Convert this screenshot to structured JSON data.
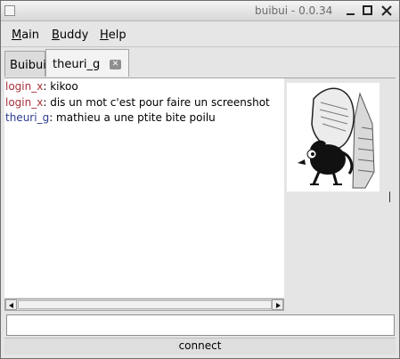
{
  "window": {
    "title": "buibui - 0.0.34"
  },
  "menubar": {
    "items": [
      {
        "label": "Main",
        "mnemonic": "M",
        "rest": "ain"
      },
      {
        "label": "Buddy",
        "mnemonic": "B",
        "rest": "uddy"
      },
      {
        "label": "Help",
        "mnemonic": "H",
        "rest": "elp"
      }
    ]
  },
  "tabs": [
    {
      "label": "Buibui",
      "active": false
    },
    {
      "label": "theuri_g",
      "active": true,
      "close_icon": "close-icon"
    }
  ],
  "chat": {
    "messages": [
      {
        "user": "login_x",
        "separator": ":",
        "text": " kikoo"
      },
      {
        "user": "login_x",
        "separator": ":",
        "text": " dis un mot c'est pour faire un screenshot"
      },
      {
        "user": "theuri_g",
        "separator": ":",
        "text": " mathieu a une ptite bite poilu"
      }
    ]
  },
  "input": {
    "value": "",
    "placeholder": ""
  },
  "status": {
    "text": "connect"
  },
  "colors": {
    "login_user": "#a7303a",
    "buddy_user": "#2b3b8f",
    "chat_background": "#ffffff"
  },
  "icons": {
    "window_minimize": "minimize-icon",
    "window_maximize": "maximize-icon",
    "window_close": "close-icon",
    "scroll_left": "chevron-left-icon",
    "scroll_right": "chevron-right-icon"
  }
}
